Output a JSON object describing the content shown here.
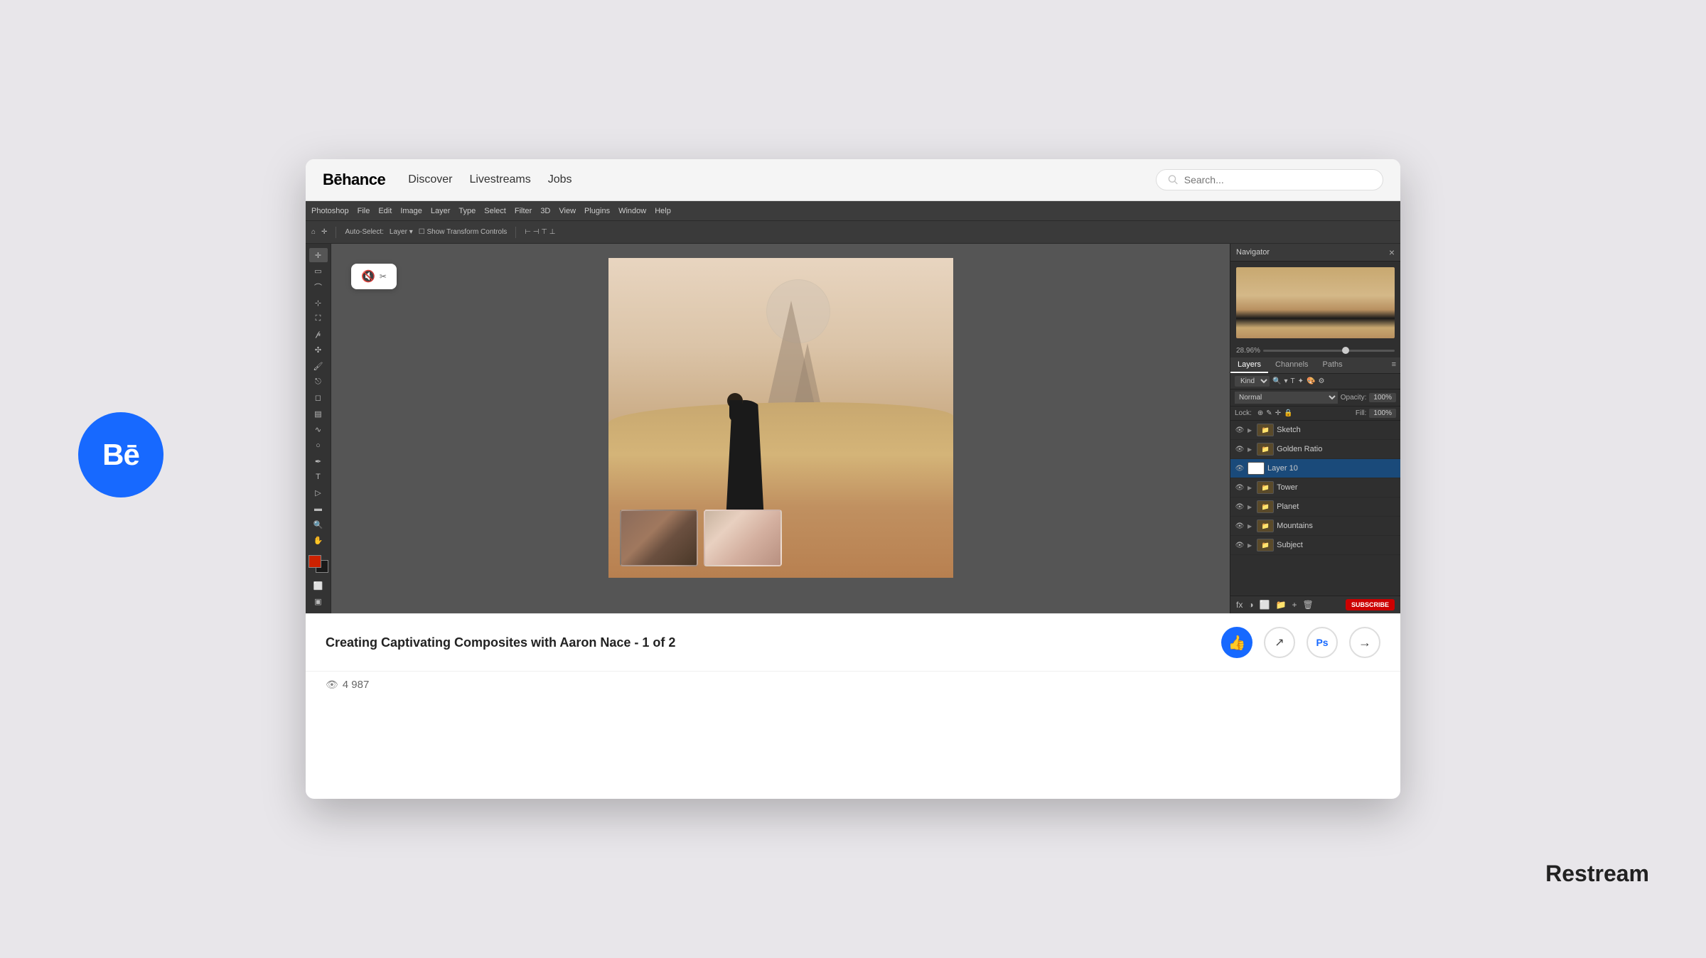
{
  "page": {
    "background_color": "#e8e6ea"
  },
  "behance_badge": {
    "text": "Bē"
  },
  "restream": {
    "label": "Restream"
  },
  "browser": {
    "nav": {
      "logo": "Bēhance",
      "links": [
        "Discover",
        "Livestreams",
        "Jobs"
      ],
      "search_placeholder": "Search..."
    },
    "photoshop": {
      "menu_items": [
        "Photoshop",
        "File",
        "Edit",
        "Image",
        "Layer",
        "Type",
        "Select",
        "Filter",
        "3D",
        "View",
        "Plugins",
        "Window",
        "Help"
      ],
      "toolbar_items": [
        "Auto-Select:",
        "Layer",
        "Show Transform Controls"
      ],
      "panels": {
        "navigator": {
          "title": "Navigator",
          "zoom_value": "28.96%"
        },
        "layers": {
          "tabs": [
            "Layers",
            "Channels",
            "Paths"
          ],
          "kind_label": "Kind",
          "blend_mode": "Normal",
          "opacity_label": "Opacity:",
          "opacity_value": "100%",
          "lock_label": "Lock:",
          "fill_label": "Fill:",
          "fill_value": "100%",
          "items": [
            {
              "name": "Sketch",
              "type": "folder",
              "visible": true
            },
            {
              "name": "Golden Ratio",
              "type": "folder",
              "visible": true
            },
            {
              "name": "Layer 10",
              "type": "layer",
              "visible": true,
              "active": true
            },
            {
              "name": "Tower",
              "type": "folder",
              "visible": true
            },
            {
              "name": "Planet",
              "type": "folder",
              "visible": true
            },
            {
              "name": "Mountains",
              "type": "folder",
              "visible": true
            },
            {
              "name": "Subject",
              "type": "folder",
              "visible": true
            }
          ]
        }
      }
    },
    "video": {
      "title": "Creating Captivating Composites with Aaron Nace - 1 of 2",
      "views": "4 987",
      "actions": {
        "like": "👍",
        "share": "↗",
        "ps_icon": "Ps",
        "next": "→"
      }
    }
  }
}
